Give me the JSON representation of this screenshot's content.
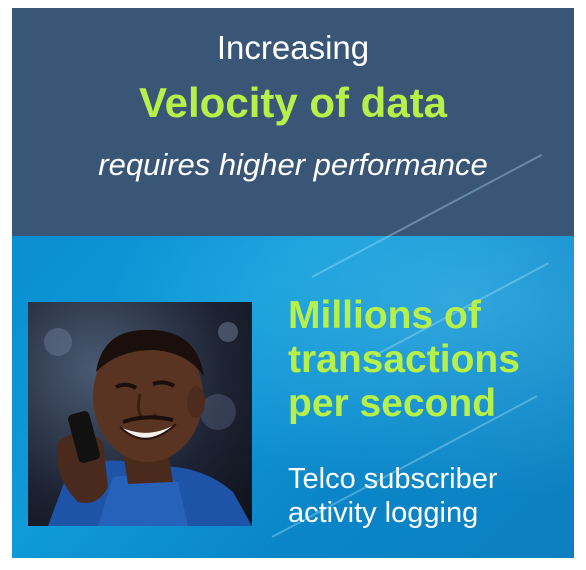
{
  "top_panel": {
    "line1": "Increasing",
    "line2": "Velocity of data",
    "line3": "requires higher performance"
  },
  "bottom_panel": {
    "headline_lines": [
      "Millions of",
      "transactions",
      "per second"
    ],
    "subtext_lines": [
      "Telco subscriber",
      "activity logging"
    ]
  },
  "colors": {
    "top_background": "#3a5676",
    "accent_green": "#b8f04a",
    "bottom_background": "#0a8fd2",
    "text_white": "#ffffff"
  },
  "icons": {
    "photo": "person-on-phone-photo"
  }
}
